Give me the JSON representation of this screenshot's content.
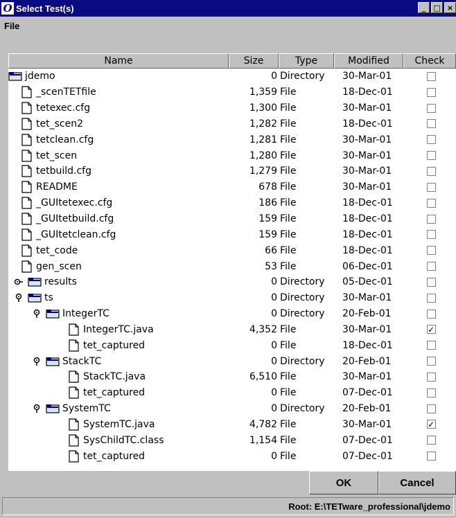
{
  "window": {
    "title": "Select Test(s)",
    "icon_letter": "O",
    "minimize": "_",
    "maximize": "□",
    "close": "×"
  },
  "menubar": {
    "file": "File"
  },
  "columns": {
    "name": "Name",
    "size": "Size",
    "type": "Type",
    "modified": "Modified",
    "check": "Check"
  },
  "rows": [
    {
      "name": "jdemo",
      "size": "0",
      "type": "Directory",
      "modified": "30-Mar-01",
      "checked": false,
      "kind": "folder",
      "indent": 0,
      "handle": "none"
    },
    {
      "name": "_scenTETfile",
      "size": "1,359",
      "type": "File",
      "modified": "18-Dec-01",
      "checked": false,
      "kind": "file",
      "indent": 1,
      "handle": "none"
    },
    {
      "name": "tetexec.cfg",
      "size": "1,300",
      "type": "File",
      "modified": "30-Mar-01",
      "checked": false,
      "kind": "file",
      "indent": 1,
      "handle": "none"
    },
    {
      "name": "tet_scen2",
      "size": "1,282",
      "type": "File",
      "modified": "18-Dec-01",
      "checked": false,
      "kind": "file",
      "indent": 1,
      "handle": "none"
    },
    {
      "name": "tetclean.cfg",
      "size": "1,281",
      "type": "File",
      "modified": "30-Mar-01",
      "checked": false,
      "kind": "file",
      "indent": 1,
      "handle": "none"
    },
    {
      "name": "tet_scen",
      "size": "1,280",
      "type": "File",
      "modified": "30-Mar-01",
      "checked": false,
      "kind": "file",
      "indent": 1,
      "handle": "none"
    },
    {
      "name": "tetbuild.cfg",
      "size": "1,279",
      "type": "File",
      "modified": "30-Mar-01",
      "checked": false,
      "kind": "file",
      "indent": 1,
      "handle": "none"
    },
    {
      "name": "README",
      "size": "678",
      "type": "File",
      "modified": "30-Mar-01",
      "checked": false,
      "kind": "file",
      "indent": 1,
      "handle": "none"
    },
    {
      "name": "_GUItetexec.cfg",
      "size": "186",
      "type": "File",
      "modified": "18-Dec-01",
      "checked": false,
      "kind": "file",
      "indent": 1,
      "handle": "none"
    },
    {
      "name": "_GUItetbuild.cfg",
      "size": "159",
      "type": "File",
      "modified": "18-Dec-01",
      "checked": false,
      "kind": "file",
      "indent": 1,
      "handle": "none"
    },
    {
      "name": "_GUItetclean.cfg",
      "size": "159",
      "type": "File",
      "modified": "18-Dec-01",
      "checked": false,
      "kind": "file",
      "indent": 1,
      "handle": "none"
    },
    {
      "name": "tet_code",
      "size": "66",
      "type": "File",
      "modified": "18-Dec-01",
      "checked": false,
      "kind": "file",
      "indent": 1,
      "handle": "none"
    },
    {
      "name": "gen_scen",
      "size": "53",
      "type": "File",
      "modified": "06-Dec-01",
      "checked": false,
      "kind": "file",
      "indent": 1,
      "handle": "none"
    },
    {
      "name": "results",
      "size": "0",
      "type": "Directory",
      "modified": "05-Dec-01",
      "checked": false,
      "kind": "folder",
      "indent": 0,
      "handle": "collapsed"
    },
    {
      "name": "ts",
      "size": "0",
      "type": "Directory",
      "modified": "30-Mar-01",
      "checked": false,
      "kind": "folder",
      "indent": 0,
      "handle": "expanded"
    },
    {
      "name": "IntegerTC",
      "size": "0",
      "type": "Directory",
      "modified": "20-Feb-01",
      "checked": false,
      "kind": "folder",
      "indent": 1,
      "handle": "expanded"
    },
    {
      "name": "IntegerTC.java",
      "size": "4,352",
      "type": "File",
      "modified": "30-Mar-01",
      "checked": true,
      "kind": "file",
      "indent": 3,
      "handle": "none"
    },
    {
      "name": "tet_captured",
      "size": "0",
      "type": "File",
      "modified": "18-Dec-01",
      "checked": false,
      "kind": "file",
      "indent": 3,
      "handle": "none"
    },
    {
      "name": "StackTC",
      "size": "0",
      "type": "Directory",
      "modified": "20-Feb-01",
      "checked": false,
      "kind": "folder",
      "indent": 1,
      "handle": "expanded"
    },
    {
      "name": "StackTC.java",
      "size": "6,510",
      "type": "File",
      "modified": "30-Mar-01",
      "checked": false,
      "kind": "file",
      "indent": 3,
      "handle": "none"
    },
    {
      "name": "tet_captured",
      "size": "0",
      "type": "File",
      "modified": "07-Dec-01",
      "checked": false,
      "kind": "file",
      "indent": 3,
      "handle": "none"
    },
    {
      "name": "SystemTC",
      "size": "0",
      "type": "Directory",
      "modified": "20-Feb-01",
      "checked": false,
      "kind": "folder",
      "indent": 1,
      "handle": "expanded"
    },
    {
      "name": "SystemTC.java",
      "size": "4,782",
      "type": "File",
      "modified": "30-Mar-01",
      "checked": true,
      "kind": "file",
      "indent": 3,
      "handle": "none"
    },
    {
      "name": "SysChildTC.class",
      "size": "1,154",
      "type": "File",
      "modified": "07-Dec-01",
      "checked": false,
      "kind": "file",
      "indent": 3,
      "handle": "none"
    },
    {
      "name": "tet_captured",
      "size": "0",
      "type": "File",
      "modified": "07-Dec-01",
      "checked": false,
      "kind": "file",
      "indent": 3,
      "handle": "none"
    }
  ],
  "buttons": {
    "ok": "OK",
    "cancel": "Cancel"
  },
  "status": {
    "root": "Root: E:\\TETware_professional\\jdemo"
  },
  "colors": {
    "titlebar": "#0a0a82",
    "face": "#c0c0c0",
    "list_bg": "#ffffff"
  }
}
